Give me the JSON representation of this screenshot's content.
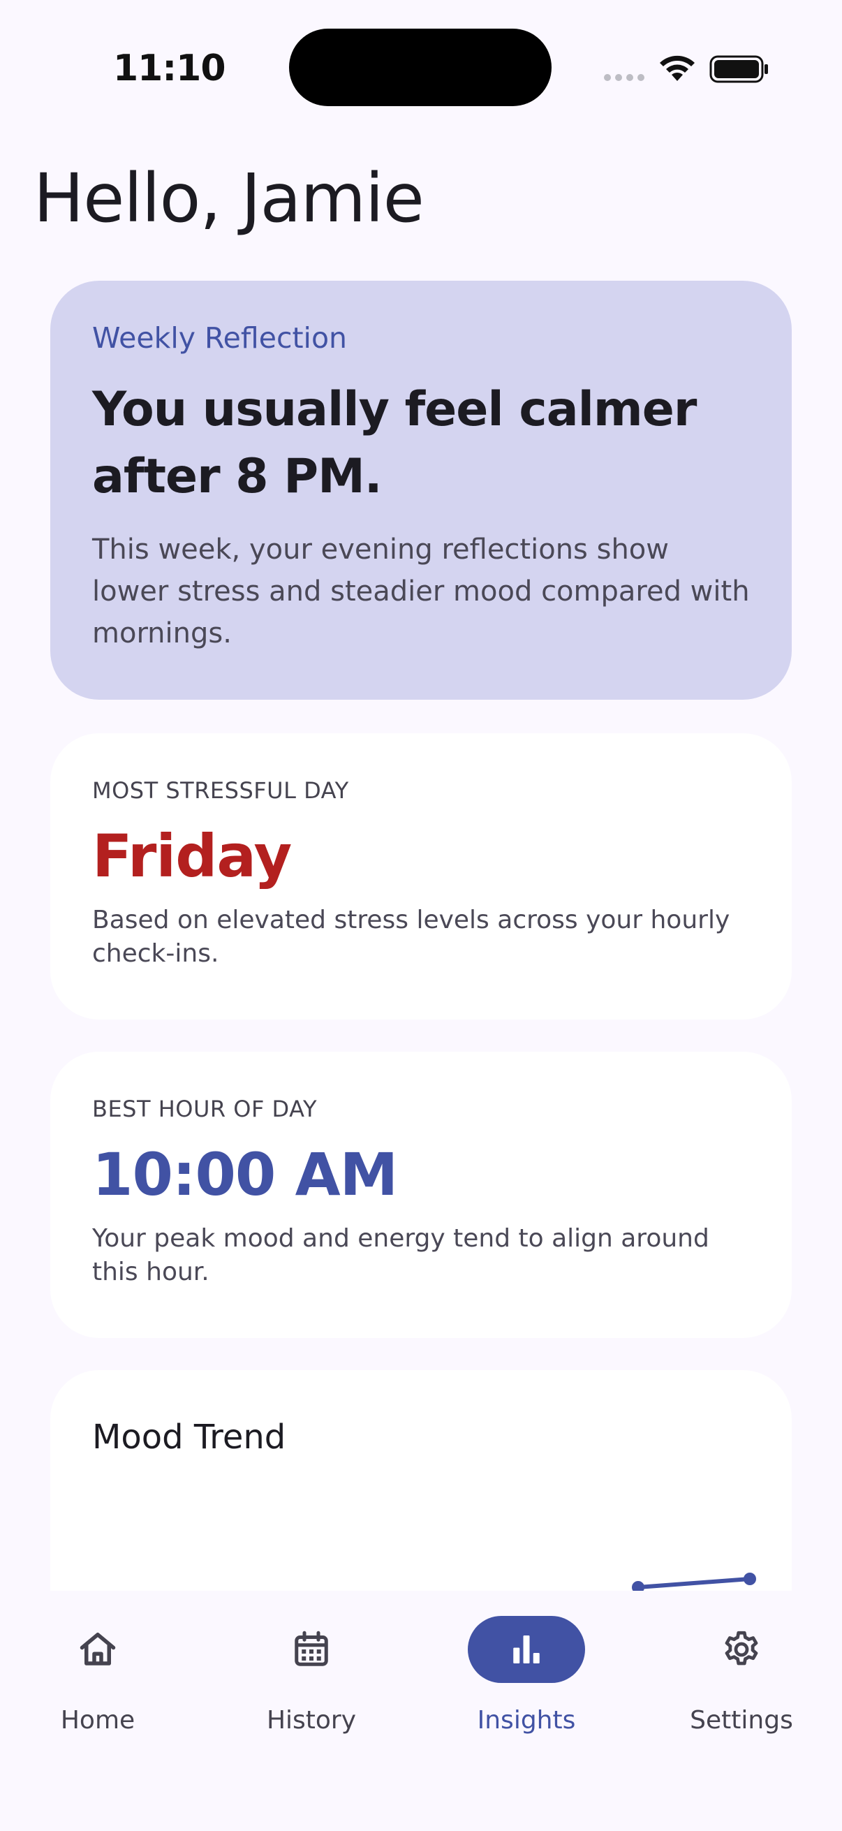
{
  "status_bar": {
    "time": "11:10"
  },
  "header": {
    "greeting": "Hello, Jamie"
  },
  "reflection_card": {
    "eyebrow": "Weekly Reflection",
    "headline": "You usually feel calmer after 8 PM.",
    "body": "This week, your evening reflections show lower stress and steadier mood compared with mornings."
  },
  "stress_card": {
    "label": "MOST STRESSFUL DAY",
    "value": "Friday",
    "description": "Based on elevated stress levels across your hourly check-ins."
  },
  "hour_card": {
    "label": "BEST HOUR OF DAY",
    "value": "10:00 AM",
    "description": "Your peak mood and energy tend to align around this hour."
  },
  "trend_card": {
    "title": "Mood Trend"
  },
  "nav": {
    "items": [
      {
        "label": "Home",
        "icon": "home-icon"
      },
      {
        "label": "History",
        "icon": "calendar-icon"
      },
      {
        "label": "Insights",
        "icon": "bar-chart-icon",
        "active": true
      },
      {
        "label": "Settings",
        "icon": "gear-icon"
      }
    ]
  },
  "colors": {
    "accent": "#4152a4",
    "stress": "#b3201f",
    "reflection_bg": "#d4d4f0",
    "background": "#fbf8ff"
  }
}
